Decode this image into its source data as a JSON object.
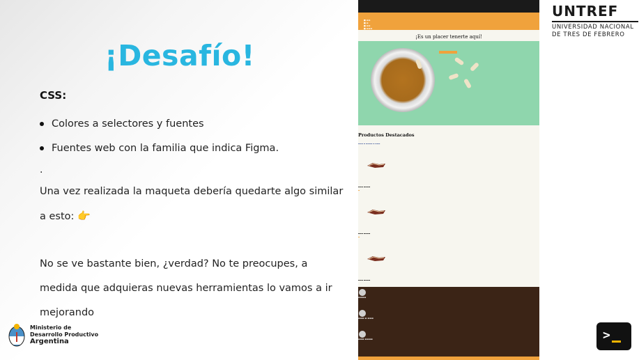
{
  "slide": {
    "title": "¡Desafío!",
    "section_label": "CSS:",
    "bullets": [
      "Colores a selectores y fuentes",
      "Fuentes web con la familia que indica Figma."
    ],
    "separator": ".",
    "paragraph1": "Una vez realizada la maqueta debería quedarte algo similar a esto:",
    "pointer_emoji": "👉",
    "paragraph2": "No se ve bastante bien, ¿verdad? No te preocupes, a medida que adquieras nuevas herramientas lo vamos a ir mejorando"
  },
  "ministry": {
    "line1": "Ministerio de",
    "line2": "Desarrollo Productivo",
    "line3": "Argentina"
  },
  "university": {
    "name": "UNTREF",
    "subtitle_line1": "UNIVERSIDAD NACIONAL",
    "subtitle_line2": "DE TRES DE FEBRERO"
  },
  "mockup": {
    "welcome": "¡Es un placer tenerte aquí!",
    "featured_title": "Productos Destacados"
  },
  "colors": {
    "title_blue": "#29b6e0",
    "nav_orange": "#f0a23c",
    "hero_green": "#8fd6ad",
    "footer_brown": "#3b2416"
  }
}
